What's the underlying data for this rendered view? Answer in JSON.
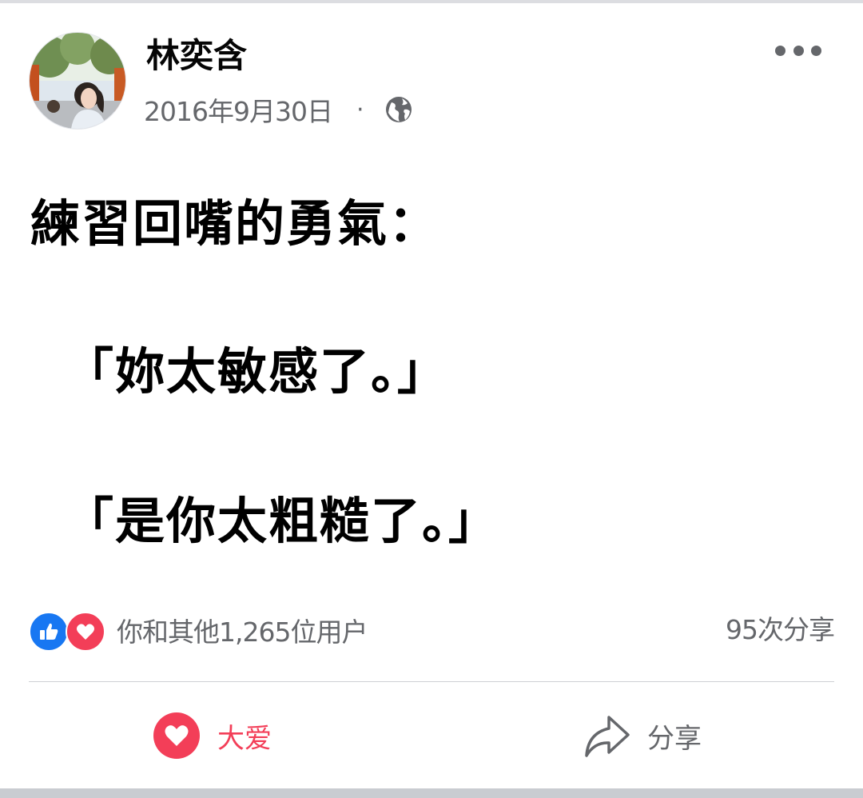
{
  "post": {
    "author": "林奕含",
    "date": "2016年9月30日",
    "separator": "·",
    "privacy_icon": "globe-icon",
    "lines": {
      "line1": "練習回嘴的勇氣：",
      "line2": "「妳太敏感了。」",
      "line3": "「是你太粗糙了。」"
    }
  },
  "footer": {
    "reactions_text": "你和其他1,265位用户",
    "shares_text": "95次分享",
    "reaction_icons": [
      "like-icon",
      "love-icon"
    ]
  },
  "actions": {
    "love_label": "大爱",
    "share_label": "分享"
  },
  "colors": {
    "like_blue": "#1877f2",
    "love_red": "#f33e58",
    "secondary_text": "#65676b"
  }
}
